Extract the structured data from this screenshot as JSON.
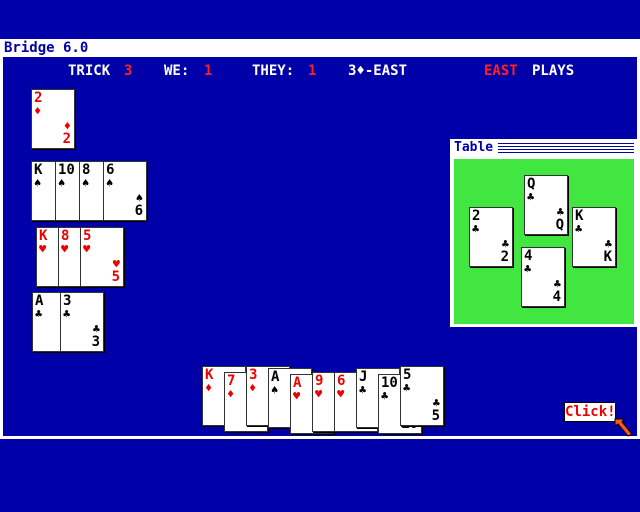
{
  "window": {
    "title": "Bridge 6.0"
  },
  "status": {
    "trick_label": "TRICK",
    "trick_value": "3",
    "we_label": "WE:",
    "we_value": "1",
    "they_label": "THEY:",
    "they_value": "1",
    "contract": "3♦-EAST",
    "turn_player": "EAST",
    "turn_text": "PLAYS"
  },
  "dummy_hand": {
    "diamonds": [
      {
        "rank": "2",
        "suit": "♦",
        "color": "red"
      }
    ],
    "spades": [
      {
        "rank": "K",
        "suit": "♠",
        "color": "black"
      },
      {
        "rank": "10",
        "suit": "♠",
        "color": "black"
      },
      {
        "rank": "8",
        "suit": "♠",
        "color": "black"
      },
      {
        "rank": "6",
        "suit": "♠",
        "color": "black"
      }
    ],
    "hearts": [
      {
        "rank": "K",
        "suit": "♥",
        "color": "red"
      },
      {
        "rank": "8",
        "suit": "♥",
        "color": "red"
      },
      {
        "rank": "5",
        "suit": "♥",
        "color": "red"
      }
    ],
    "clubs": [
      {
        "rank": "A",
        "suit": "♣",
        "color": "black"
      },
      {
        "rank": "3",
        "suit": "♣",
        "color": "black"
      }
    ]
  },
  "table_window": {
    "title": "Table",
    "cards": [
      {
        "position": "north",
        "rank": "Q",
        "suit": "♣"
      },
      {
        "position": "west",
        "rank": "2",
        "suit": "♣"
      },
      {
        "position": "east",
        "rank": "K",
        "suit": "♣"
      },
      {
        "position": "south",
        "rank": "4",
        "suit": "♣"
      }
    ]
  },
  "player_hand": [
    {
      "rank": "K",
      "suit": "♦",
      "color": "red"
    },
    {
      "rank": "7",
      "suit": "♦",
      "color": "red"
    },
    {
      "rank": "3",
      "suit": "♦",
      "color": "red"
    },
    {
      "rank": "A",
      "suit": "♠",
      "color": "black"
    },
    {
      "rank": "A",
      "suit": "♥",
      "color": "red"
    },
    {
      "rank": "9",
      "suit": "♥",
      "color": "red"
    },
    {
      "rank": "6",
      "suit": "♥",
      "color": "red"
    },
    {
      "rank": "J",
      "suit": "♣",
      "color": "black"
    },
    {
      "rank": "10",
      "suit": "♣",
      "color": "black"
    },
    {
      "rank": "5",
      "suit": "♣",
      "color": "black"
    }
  ],
  "click_button": "Click!",
  "colors": {
    "background": "#0000a8",
    "felt": "#41e641",
    "accent_red": "#ff2222"
  }
}
